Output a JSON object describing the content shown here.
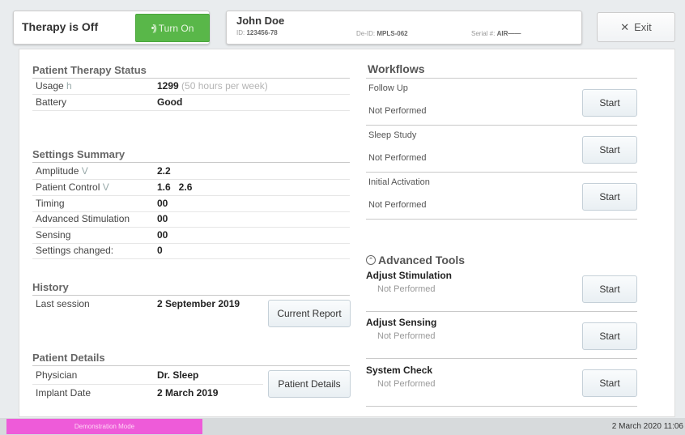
{
  "header": {
    "therapy_status": "Therapy is Off",
    "turn_on_label": "Turn On",
    "patient": {
      "name": "John Doe",
      "id_label": "ID:",
      "id_value": "123456-78",
      "deid_label": "De-ID:",
      "deid_value": "MPLS-062",
      "serial_label": "Serial #:",
      "serial_value": "AIR——"
    },
    "exit_label": "Exit"
  },
  "therapy": {
    "title": "Patient Therapy Status",
    "usage_label": "Usage",
    "usage_unit": "h",
    "usage_value": "1299",
    "usage_note": "(50 hours per week)",
    "battery_label": "Battery",
    "battery_value": "Good"
  },
  "settings": {
    "title": "Settings Summary",
    "rows": [
      {
        "label": "Amplitude",
        "unit": "V",
        "value": "2.2"
      },
      {
        "label": "Patient Control",
        "unit": "V",
        "value": "1.6   2.6"
      },
      {
        "label": "Timing",
        "unit": "",
        "value": "00"
      },
      {
        "label": "Advanced Stimulation",
        "unit": "",
        "value": "00"
      },
      {
        "label": "Sensing",
        "unit": "",
        "value": "00"
      },
      {
        "label": "Settings changed:",
        "unit": "",
        "value": "0"
      }
    ]
  },
  "history": {
    "title": "History",
    "last_session_label": "Last session",
    "last_session_value": "2 September 2019",
    "report_button": "Current Report"
  },
  "patient_details": {
    "title": "Patient Details",
    "physician_label": "Physician",
    "physician_value": "Dr. Sleep",
    "implant_label": "Implant Date",
    "implant_value": "2 March 2019",
    "button": "Patient Details"
  },
  "workflows": {
    "title": "Workflows",
    "items": [
      {
        "name": "Follow Up",
        "status": "Not Performed",
        "button": "Start"
      },
      {
        "name": "Sleep Study",
        "status": "Not Performed",
        "button": "Start"
      },
      {
        "name": "Initial Activation",
        "status": "Not Performed",
        "button": "Start"
      }
    ]
  },
  "advanced_tools": {
    "title": "Advanced Tools",
    "items": [
      {
        "name": "Adjust Stimulation",
        "status": "Not Performed",
        "button": "Start"
      },
      {
        "name": "Adjust Sensing",
        "status": "Not Performed",
        "button": "Start"
      },
      {
        "name": "System Check",
        "status": "Not Performed",
        "button": "Start"
      }
    ]
  },
  "footer": {
    "mode": "Demonstration Mode",
    "datetime": "2 March 2020 11:06"
  },
  "colors": {
    "turn_on": "#59b749",
    "demo_mode": "#ee5bd9"
  }
}
